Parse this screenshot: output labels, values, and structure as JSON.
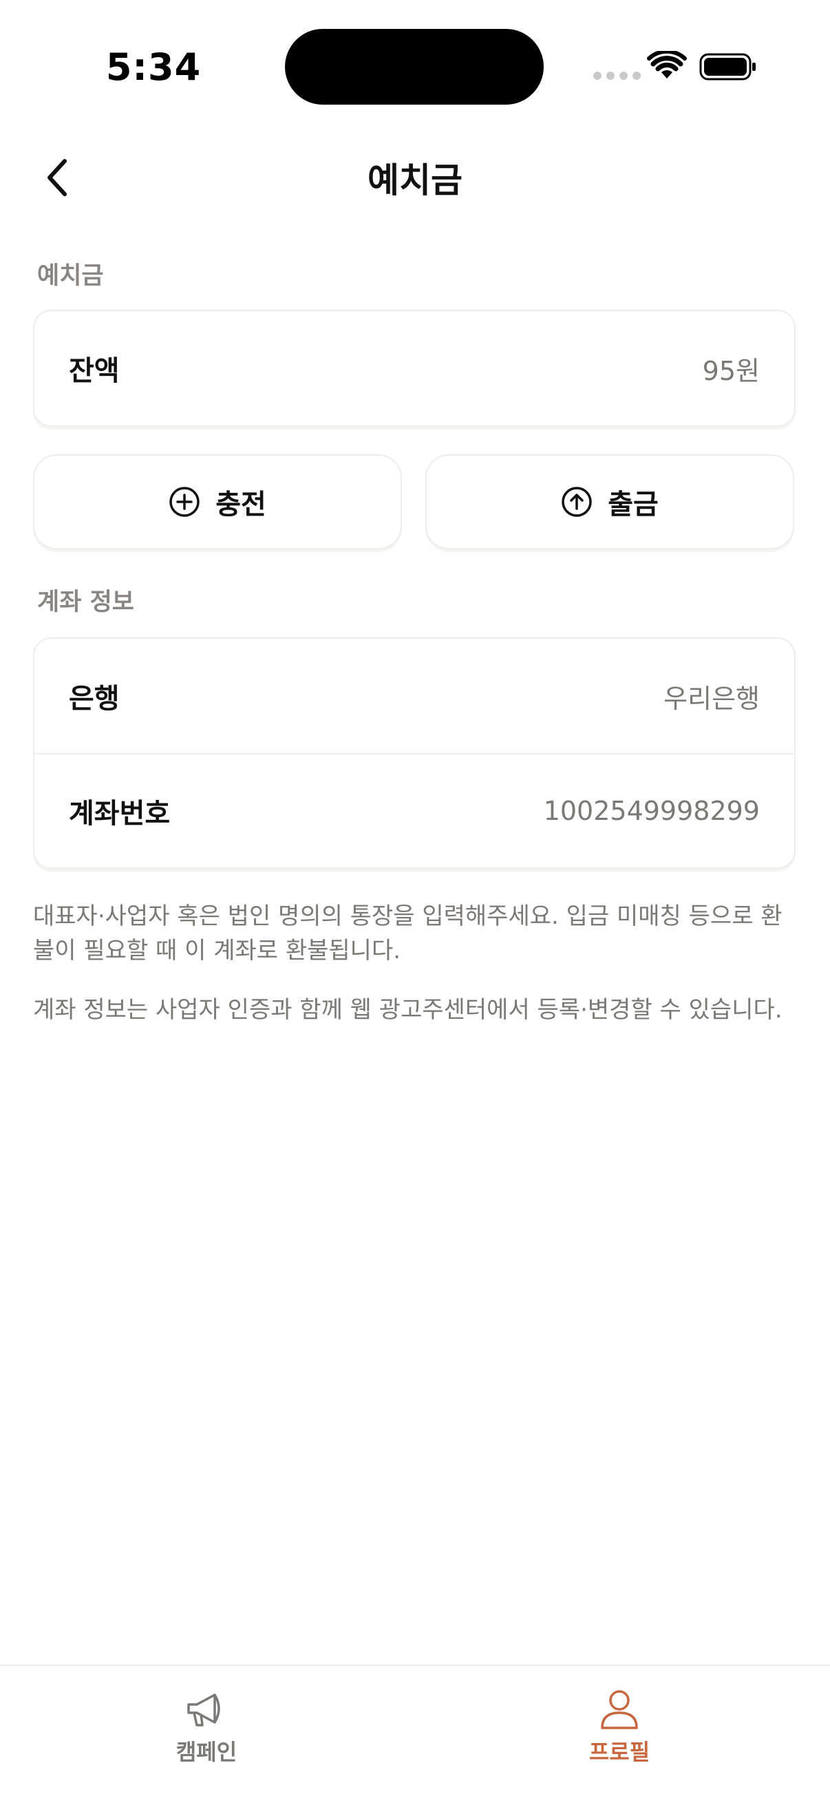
{
  "status_bar": {
    "time": "5:34"
  },
  "header": {
    "title": "예치금"
  },
  "deposit": {
    "section_label": "예치금",
    "balance_label": "잔액",
    "balance_value": "95원"
  },
  "actions": {
    "charge_label": "충전",
    "withdraw_label": "출금"
  },
  "account": {
    "section_label": "계좌 정보",
    "bank_label": "은행",
    "bank_value": "우리은행",
    "number_label": "계좌번호",
    "number_value": "1002549998299"
  },
  "notes": {
    "line1": "대표자·사업자 혹은 법인 명의의 통장을 입력해주세요. 입금 미매칭 등으로 환불이 필요할 때 이 계좌로 환불됩니다.",
    "line2": "계좌 정보는 사업자 인증과 함께 웹 광고주센터에서 등록·변경할 수 있습니다."
  },
  "tabbar": {
    "campaign_label": "캠페인",
    "profile_label": "프로필",
    "active_tab": "profile",
    "active_color": "#c8673f",
    "inactive_color": "#7c7873"
  },
  "icons": {
    "back": "chevron-left-icon",
    "charge": "plus-circle-icon",
    "withdraw": "arrow-up-circle-icon",
    "campaign": "megaphone-icon",
    "profile": "user-icon"
  }
}
